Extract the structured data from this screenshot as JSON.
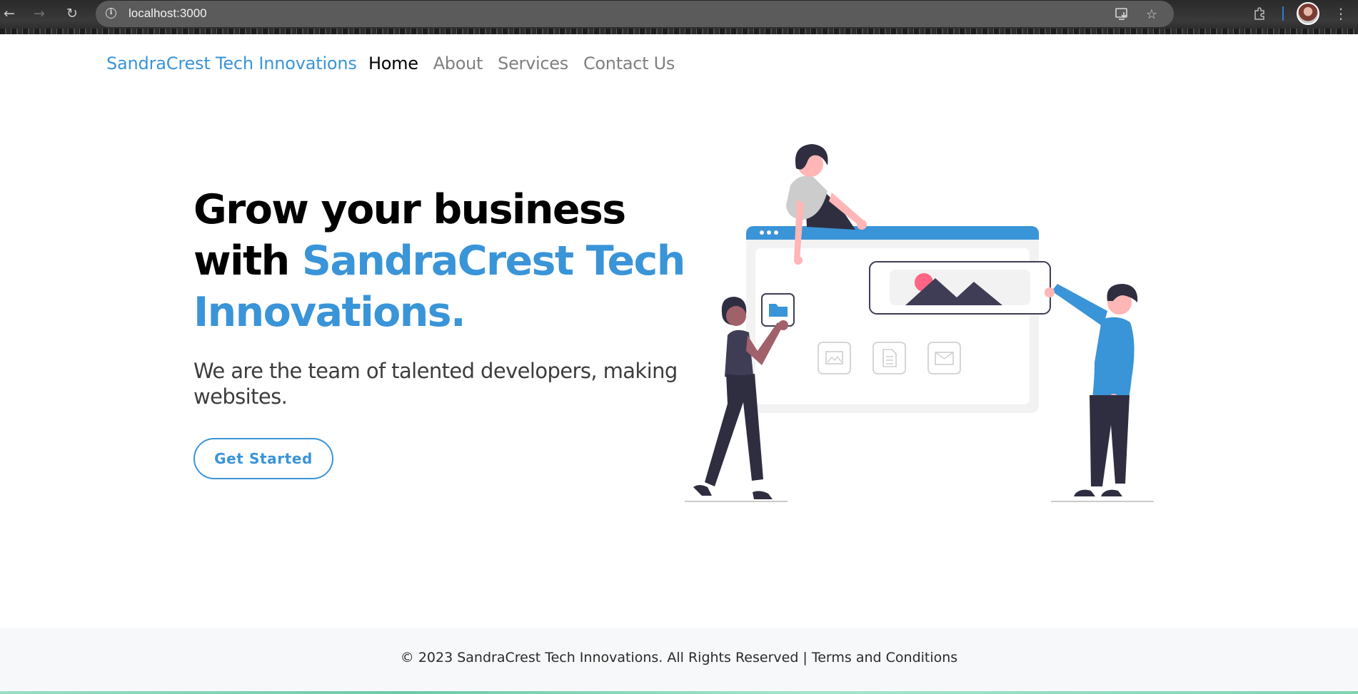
{
  "browser": {
    "url": "localhost:3000",
    "icons": [
      "back-icon",
      "forward-icon",
      "reload-icon",
      "site-info-icon",
      "install-app-icon",
      "bookmark-star-icon",
      "extensions-icon",
      "profile-avatar",
      "menu-icon"
    ]
  },
  "nav": {
    "brand": "SandraCrest Tech Innovations",
    "items": [
      {
        "label": "Home",
        "active": true
      },
      {
        "label": "About",
        "active": false
      },
      {
        "label": "Services",
        "active": false
      },
      {
        "label": "Contact Us",
        "active": false
      }
    ]
  },
  "hero": {
    "title_prefix": "Grow your business with ",
    "title_highlight": "SandraCrest Tech Innovations.",
    "subtitle": "We are the team of talented developers, making websites.",
    "cta_label": "Get Started"
  },
  "footer": {
    "text": "© 2023 SandraCrest Tech Innovations. All Rights Reserved | ",
    "link": "Terms and Conditions"
  },
  "colors": {
    "accent": "#3a94d8",
    "dark_figure": "#2f2e41",
    "skin": "#ffb6b6",
    "highlight_pink": "#ff6584"
  }
}
